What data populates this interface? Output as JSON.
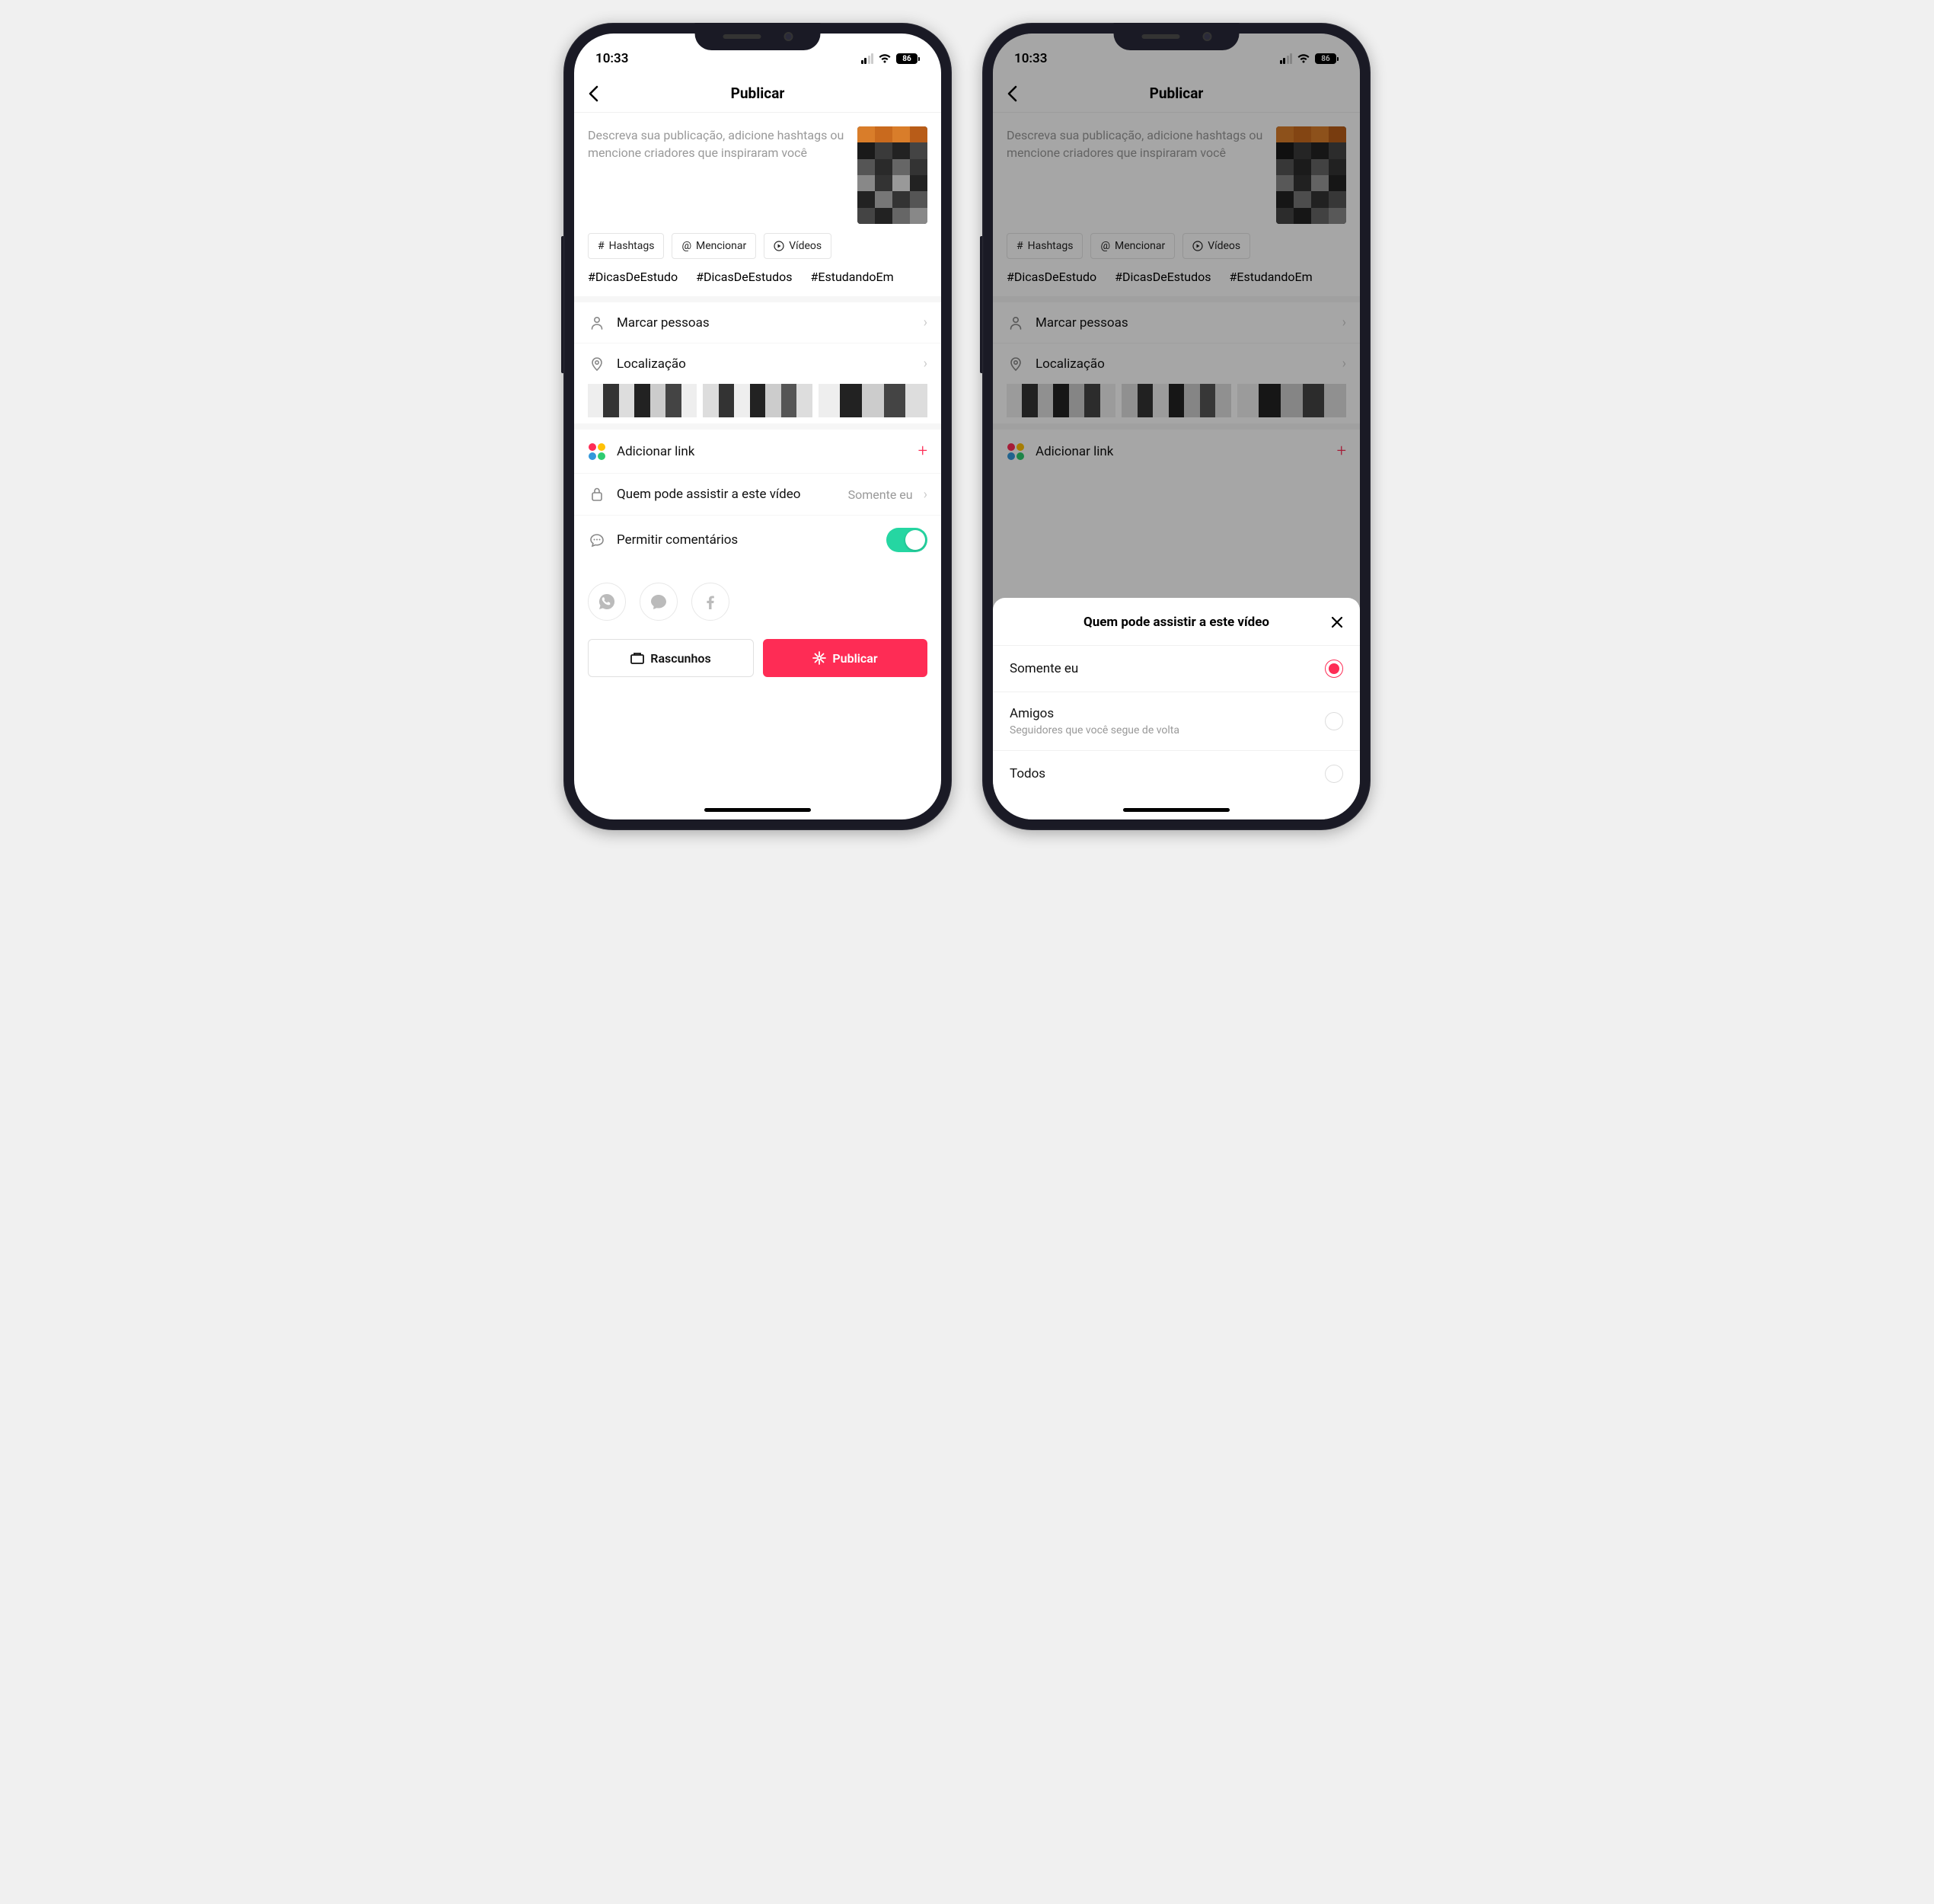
{
  "status": {
    "time": "10:33",
    "battery": "86"
  },
  "header": {
    "title": "Publicar"
  },
  "caption_placeholder": "Descreva sua publicação, adicione hashtags ou mencione criadores que inspiraram você",
  "chips": [
    {
      "icon": "#",
      "label": "Hashtags"
    },
    {
      "icon": "@",
      "label": "Mencionar"
    },
    {
      "icon": "▷",
      "label": "Vídeos"
    }
  ],
  "suggested_hashtags": [
    "#DicasDeEstudo",
    "#DicasDeEstudos",
    "#EstudandoEm"
  ],
  "rows": {
    "tag_people": "Marcar pessoas",
    "location": "Localização",
    "add_link": "Adicionar link",
    "privacy_label": "Quem pode assistir a este vídeo",
    "privacy_value": "Somente eu",
    "comments": "Permitir comentários"
  },
  "buttons": {
    "drafts": "Rascunhos",
    "publish": "Publicar"
  },
  "sheet": {
    "title": "Quem pode assistir a este vídeo",
    "options": [
      {
        "label": "Somente eu",
        "sub": "",
        "selected": true
      },
      {
        "label": "Amigos",
        "sub": "Seguidores que você segue de volta",
        "selected": false
      },
      {
        "label": "Todos",
        "sub": "",
        "selected": false
      }
    ]
  }
}
